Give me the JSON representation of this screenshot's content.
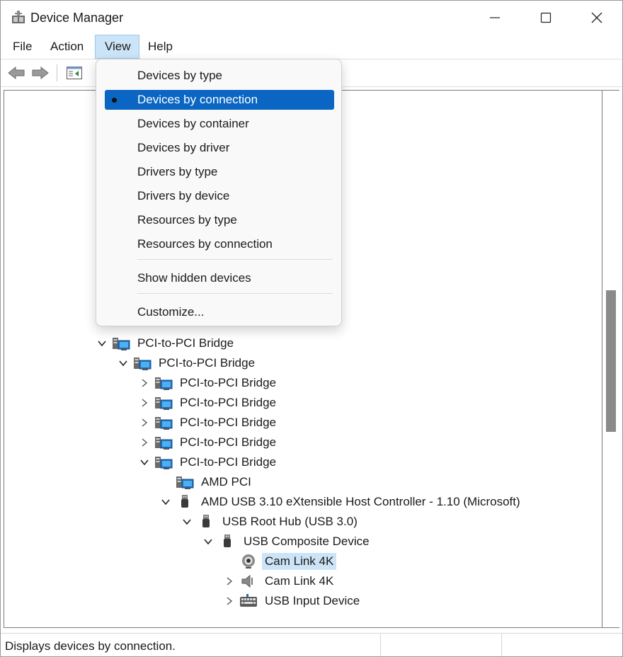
{
  "window": {
    "title": "Device Manager"
  },
  "menubar": {
    "items": [
      "File",
      "Action",
      "View",
      "Help"
    ]
  },
  "view_menu": {
    "items": [
      "Devices by type",
      "Devices by connection",
      "Devices by container",
      "Devices by driver",
      "Drivers by type",
      "Drivers by device",
      "Resources by type",
      "Resources by connection",
      "Show hidden devices",
      "Customize..."
    ],
    "selected": "Devices by connection"
  },
  "tree": {
    "rows": [
      {
        "label": "PCI-to-PCI Bridge",
        "icon": "pci-bridge-icon",
        "expander": "expanded"
      },
      {
        "label": "PCI-to-PCI Bridge",
        "icon": "pci-bridge-icon",
        "expander": "expanded"
      },
      {
        "label": "PCI-to-PCI Bridge",
        "icon": "pci-bridge-icon",
        "expander": "collapsed"
      },
      {
        "label": "PCI-to-PCI Bridge",
        "icon": "pci-bridge-icon",
        "expander": "collapsed"
      },
      {
        "label": "PCI-to-PCI Bridge",
        "icon": "pci-bridge-icon",
        "expander": "collapsed"
      },
      {
        "label": "PCI-to-PCI Bridge",
        "icon": "pci-bridge-icon",
        "expander": "collapsed"
      },
      {
        "label": "PCI-to-PCI Bridge",
        "icon": "pci-bridge-icon",
        "expander": "expanded"
      },
      {
        "label": "AMD PCI",
        "icon": "pci-bridge-icon",
        "expander": "none"
      },
      {
        "label": "AMD USB 3.10 eXtensible Host Controller - 1.10 (Microsoft)",
        "icon": "usb-plug-icon",
        "expander": "expanded"
      },
      {
        "label": "USB Root Hub (USB 3.0)",
        "icon": "usb-plug-icon",
        "expander": "expanded"
      },
      {
        "label": "USB Composite Device",
        "icon": "usb-plug-icon",
        "expander": "expanded"
      },
      {
        "label": "Cam Link 4K",
        "icon": "webcam-icon",
        "expander": "none",
        "selected": true
      },
      {
        "label": "Cam Link 4K",
        "icon": "speaker-icon",
        "expander": "collapsed"
      },
      {
        "label": "USB Input Device",
        "icon": "keyboard-icon",
        "expander": "collapsed"
      }
    ]
  },
  "statusbar": {
    "text": "Displays devices by connection."
  },
  "colors": {
    "highlight": "#0a66c2",
    "selection": "#cce4f7",
    "menu_active": "#cce4f7"
  }
}
